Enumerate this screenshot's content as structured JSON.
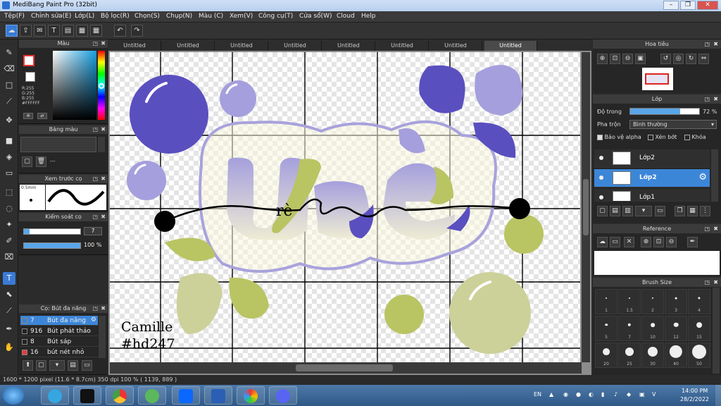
{
  "app": {
    "title": "MediBang Paint Pro (32bit)"
  },
  "menu": [
    "Tệp(F)",
    "Chỉnh sửa(E)",
    "Lớp(L)",
    "Bộ lọc(R)",
    "Chọn(S)",
    "Chụp(N)",
    "Màu (C)",
    "Xem(V)",
    "Công cụ(T)",
    "Cửa sổ(W)",
    "Cloud",
    "Help"
  ],
  "tabs": [
    "Untitled",
    "Untitled",
    "Untitled",
    "Untitled",
    "Untitled",
    "Untitled",
    "Untitled",
    "Untitled"
  ],
  "color_panel": {
    "title": "Màu",
    "r": "R:255",
    "g": "G:255",
    "b": "B:255",
    "hex": "#FFFFFF"
  },
  "palette_panel": {
    "title": "Bảng màu",
    "dash": "---"
  },
  "brush_preview": {
    "title": "Xem trước cọ",
    "size": "0.5mm"
  },
  "brush_control": {
    "title": "Kiểm soát cọ",
    "size": "7",
    "opacity": "100 %"
  },
  "brush_list": {
    "title": "Cọ: Bút đa năng",
    "items": [
      {
        "size": "7",
        "name": "Bút đa năng",
        "color": "#3d7fd4"
      },
      {
        "size": "916",
        "name": "Bút phát thảo",
        "color": "#222222"
      },
      {
        "size": "8",
        "name": "Bút sáp",
        "color": "#222222"
      },
      {
        "size": "16",
        "name": "bút nét nhỏ",
        "color": "#e83b3b"
      }
    ]
  },
  "navigator": {
    "title": "Hoa tiêu"
  },
  "layer_panel": {
    "title": "Lớp",
    "opacity_label": "Độ trong",
    "opacity_value": "72 %",
    "opacity": 0.72,
    "blend_label": "Pha trộn",
    "blend_value": "Bình thường",
    "protect_alpha": "Bảo vệ alpha",
    "clipping": "Xén bớt",
    "lock": "Khóa",
    "layers": [
      {
        "name": "Lớp2",
        "selected": false
      },
      {
        "name": "Lớp2",
        "selected": true
      },
      {
        "name": "Lớp1",
        "selected": false
      }
    ]
  },
  "reference": {
    "title": "Reference"
  },
  "brush_size": {
    "title": "Brush Size",
    "sizes": [
      "1",
      "1.5",
      "2",
      "3",
      "4",
      "5",
      "7",
      "10",
      "12",
      "15",
      "20",
      "25",
      "30",
      "40",
      "50"
    ]
  },
  "status": {
    "text": "1600 * 1200 pixel  (11.6 * 8.7cm)  350 dpi  100 %  ( 1139, 889 )"
  },
  "canvas_text": {
    "name": "Camille",
    "tag": "#hd247",
    "title": "rè"
  },
  "taskbar": {
    "lang": "EN",
    "time": "14:00 PM",
    "date": "28/2/2022"
  },
  "colors": {
    "purple": "#5a4fbf",
    "lavender": "#a59fdd",
    "lime": "#b9c463",
    "sage": "#ccd19a",
    "selection_blue": "#3c86d8"
  }
}
